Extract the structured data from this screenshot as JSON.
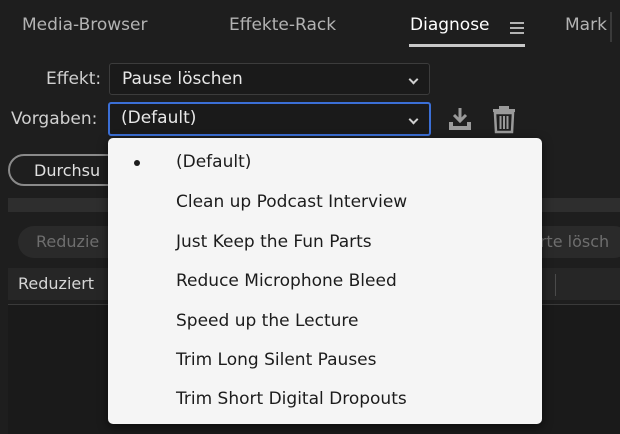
{
  "tabs": [
    {
      "label": "Media-Browser",
      "active": false
    },
    {
      "label": "Effekte-Rack",
      "active": false
    },
    {
      "label": "Diagnose",
      "active": true
    },
    {
      "label": "Mark",
      "active": false
    }
  ],
  "effect": {
    "label": "Effekt:",
    "value": "Pause löschen"
  },
  "presets": {
    "label": "Vorgaben:",
    "value": "(Default)",
    "save_icon": "save-preset-icon",
    "delete_icon": "trash-icon"
  },
  "scan_button": "Durchsu",
  "ghost_left": "Reduzie",
  "ghost_right": "erte lösch",
  "table_header": "Reduziert",
  "menu": {
    "selected_index": 0,
    "items": [
      "(Default)",
      "Clean up Podcast Interview",
      "Just Keep the Fun Parts",
      "Reduce Microphone Bleed",
      "Speed up the Lecture",
      "Trim Long Silent Pauses",
      "Trim Short Digital Dropouts"
    ]
  },
  "colors": {
    "background": "#1e1e1e",
    "focus_border": "#3b6fd6",
    "menu_background": "#f5f5f5"
  }
}
